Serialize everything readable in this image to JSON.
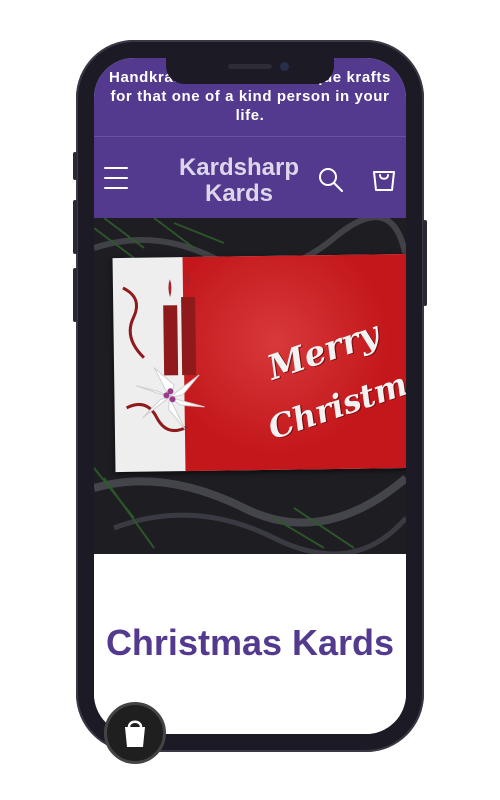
{
  "announcement": {
    "text": "Handkrafted kards and unique krafts for that one of a kind person in your life."
  },
  "header": {
    "brand": "Kardsharp Kards",
    "icons": {
      "menu": "menu-icon",
      "search": "search-icon",
      "cart": "cart-icon"
    }
  },
  "hero": {
    "card_line_1": "Merry",
    "card_line_2": "Christmas"
  },
  "collection": {
    "title": "Christmas Kards"
  },
  "colors": {
    "brand_purple": "#533a8f",
    "header_text": "#ddd6ea",
    "card_red": "#c3171b"
  },
  "badge": {
    "icon": "shop-bag-icon"
  }
}
